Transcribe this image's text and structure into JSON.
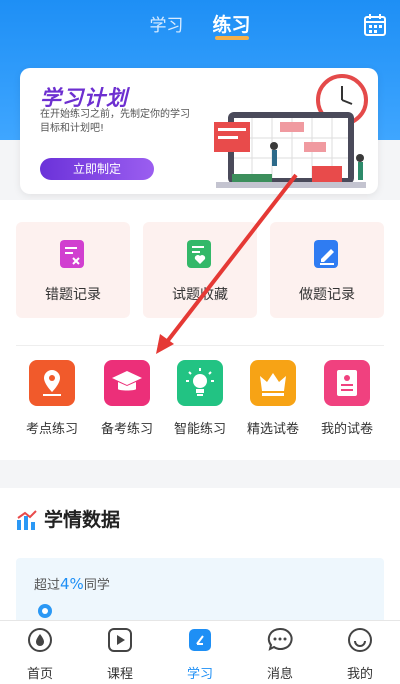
{
  "header": {
    "tabs": [
      {
        "label": "学习"
      },
      {
        "label": "练习"
      }
    ],
    "calendar_icon": "calendar-icon"
  },
  "banner": {
    "title": "学习计划",
    "description": "在开始练习之前，先制定你的学习目标和计划吧!",
    "button": "立即制定"
  },
  "cards": [
    {
      "label": "错题记录",
      "icon": "error-record-icon",
      "color": "#d13fd0"
    },
    {
      "label": "试题收藏",
      "icon": "favorite-icon",
      "color": "#33b869"
    },
    {
      "label": "做题记录",
      "icon": "practice-record-icon",
      "color": "#2f7cf2"
    }
  ],
  "practice": [
    {
      "label": "考点练习",
      "icon": "location-pin-icon",
      "color": "#f15a2b"
    },
    {
      "label": "备考练习",
      "icon": "graduation-cap-icon",
      "color": "#ec2f79"
    },
    {
      "label": "智能练习",
      "icon": "lightbulb-icon",
      "color": "#22c383"
    },
    {
      "label": "精选试卷",
      "icon": "crown-icon",
      "color": "#f7a315"
    },
    {
      "label": "我的试卷",
      "icon": "paper-icon",
      "color": "#f0417f"
    }
  ],
  "stats": {
    "title": "学情数据",
    "prefix": "超过",
    "percent": "4%",
    "suffix": "同学"
  },
  "nav": [
    {
      "label": "首页",
      "icon": "home-icon"
    },
    {
      "label": "课程",
      "icon": "course-icon"
    },
    {
      "label": "学习",
      "icon": "study-icon",
      "active": true
    },
    {
      "label": "消息",
      "icon": "message-icon"
    },
    {
      "label": "我的",
      "icon": "profile-icon"
    }
  ]
}
